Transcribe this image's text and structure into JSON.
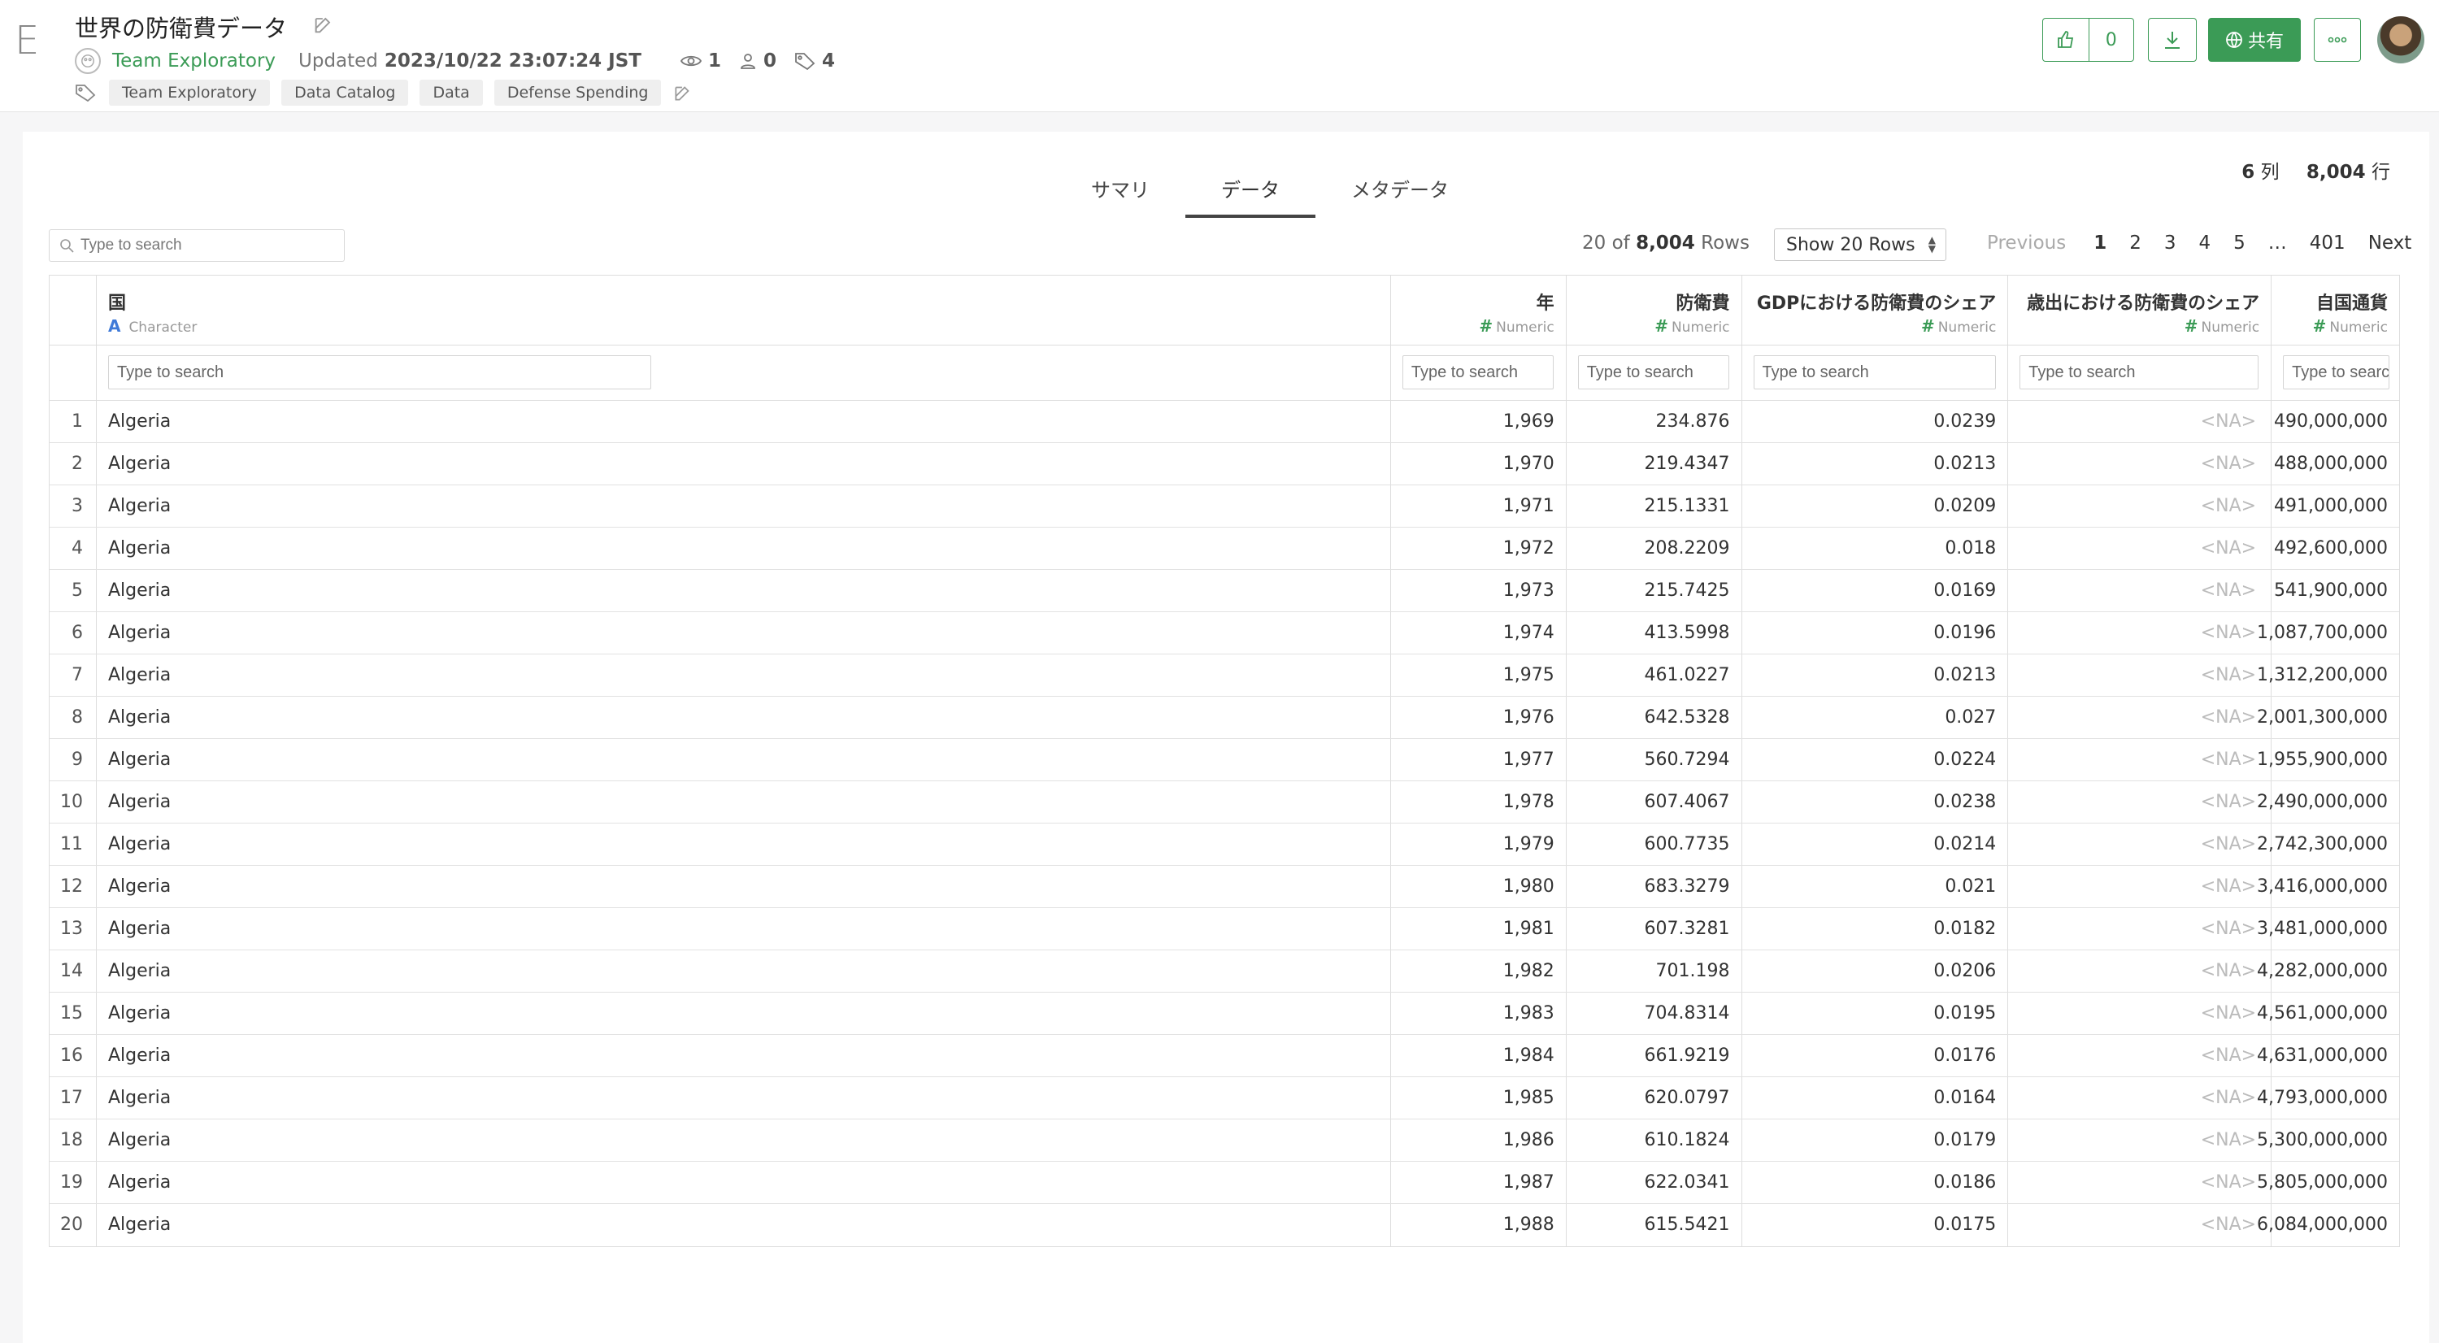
{
  "header": {
    "logo": "E",
    "title": "世界の防衛費データ",
    "team": "Team Exploratory",
    "updated_label": "Updated",
    "updated_value": "2023/10/22 23:07:24 JST",
    "views": "1",
    "downloads": "0",
    "tag_count": "4",
    "tags": [
      "Team Exploratory",
      "Data Catalog",
      "Data",
      "Defense Spending"
    ],
    "like_count": "0",
    "share_label": "共有"
  },
  "tabs": [
    "サマリ",
    "データ",
    "メタデータ"
  ],
  "active_tab": "データ",
  "counts": {
    "cols": "6",
    "cols_unit": "列",
    "rows": "8,004",
    "rows_unit": "行"
  },
  "search": {
    "placeholder": "Type to search"
  },
  "rows_info": {
    "shown": "20 of",
    "total": "8,004",
    "unit": "Rows"
  },
  "show_rows": "Show 20 Rows",
  "pager": {
    "previous": "Previous",
    "pages": [
      "1",
      "2",
      "3",
      "4",
      "5"
    ],
    "ellipsis": "…",
    "last": "401",
    "next": "Next",
    "current": "1"
  },
  "columns": [
    {
      "name": "国",
      "type": "Character"
    },
    {
      "name": "年",
      "type": "Numeric"
    },
    {
      "name": "防衛費",
      "type": "Numeric"
    },
    {
      "name": "GDPにおける防衛費のシェア",
      "type": "Numeric"
    },
    {
      "name": "歳出における防衛費のシェア",
      "type": "Numeric"
    },
    {
      "name": "自国通貨",
      "type": "Numeric"
    }
  ],
  "filter_placeholder": "Type to search",
  "rows": [
    [
      "1",
      "Algeria",
      "1,969",
      "234.876",
      "0.0239",
      "<NA>",
      "490,000,000"
    ],
    [
      "2",
      "Algeria",
      "1,970",
      "219.4347",
      "0.0213",
      "<NA>",
      "488,000,000"
    ],
    [
      "3",
      "Algeria",
      "1,971",
      "215.1331",
      "0.0209",
      "<NA>",
      "491,000,000"
    ],
    [
      "4",
      "Algeria",
      "1,972",
      "208.2209",
      "0.018",
      "<NA>",
      "492,600,000"
    ],
    [
      "5",
      "Algeria",
      "1,973",
      "215.7425",
      "0.0169",
      "<NA>",
      "541,900,000"
    ],
    [
      "6",
      "Algeria",
      "1,974",
      "413.5998",
      "0.0196",
      "<NA>",
      "1,087,700,000"
    ],
    [
      "7",
      "Algeria",
      "1,975",
      "461.0227",
      "0.0213",
      "<NA>",
      "1,312,200,000"
    ],
    [
      "8",
      "Algeria",
      "1,976",
      "642.5328",
      "0.027",
      "<NA>",
      "2,001,300,000"
    ],
    [
      "9",
      "Algeria",
      "1,977",
      "560.7294",
      "0.0224",
      "<NA>",
      "1,955,900,000"
    ],
    [
      "10",
      "Algeria",
      "1,978",
      "607.4067",
      "0.0238",
      "<NA>",
      "2,490,000,000"
    ],
    [
      "11",
      "Algeria",
      "1,979",
      "600.7735",
      "0.0214",
      "<NA>",
      "2,742,300,000"
    ],
    [
      "12",
      "Algeria",
      "1,980",
      "683.3279",
      "0.021",
      "<NA>",
      "3,416,000,000"
    ],
    [
      "13",
      "Algeria",
      "1,981",
      "607.3281",
      "0.0182",
      "<NA>",
      "3,481,000,000"
    ],
    [
      "14",
      "Algeria",
      "1,982",
      "701.198",
      "0.0206",
      "<NA>",
      "4,282,000,000"
    ],
    [
      "15",
      "Algeria",
      "1,983",
      "704.8314",
      "0.0195",
      "<NA>",
      "4,561,000,000"
    ],
    [
      "16",
      "Algeria",
      "1,984",
      "661.9219",
      "0.0176",
      "<NA>",
      "4,631,000,000"
    ],
    [
      "17",
      "Algeria",
      "1,985",
      "620.0797",
      "0.0164",
      "<NA>",
      "4,793,000,000"
    ],
    [
      "18",
      "Algeria",
      "1,986",
      "610.1824",
      "0.0179",
      "<NA>",
      "5,300,000,000"
    ],
    [
      "19",
      "Algeria",
      "1,987",
      "622.0341",
      "0.0186",
      "<NA>",
      "5,805,000,000"
    ],
    [
      "20",
      "Algeria",
      "1,988",
      "615.5421",
      "0.0175",
      "<NA>",
      "6,084,000,000"
    ]
  ],
  "colors": {
    "accent": "#3b9b56",
    "character_type": "#3f7ad8"
  }
}
